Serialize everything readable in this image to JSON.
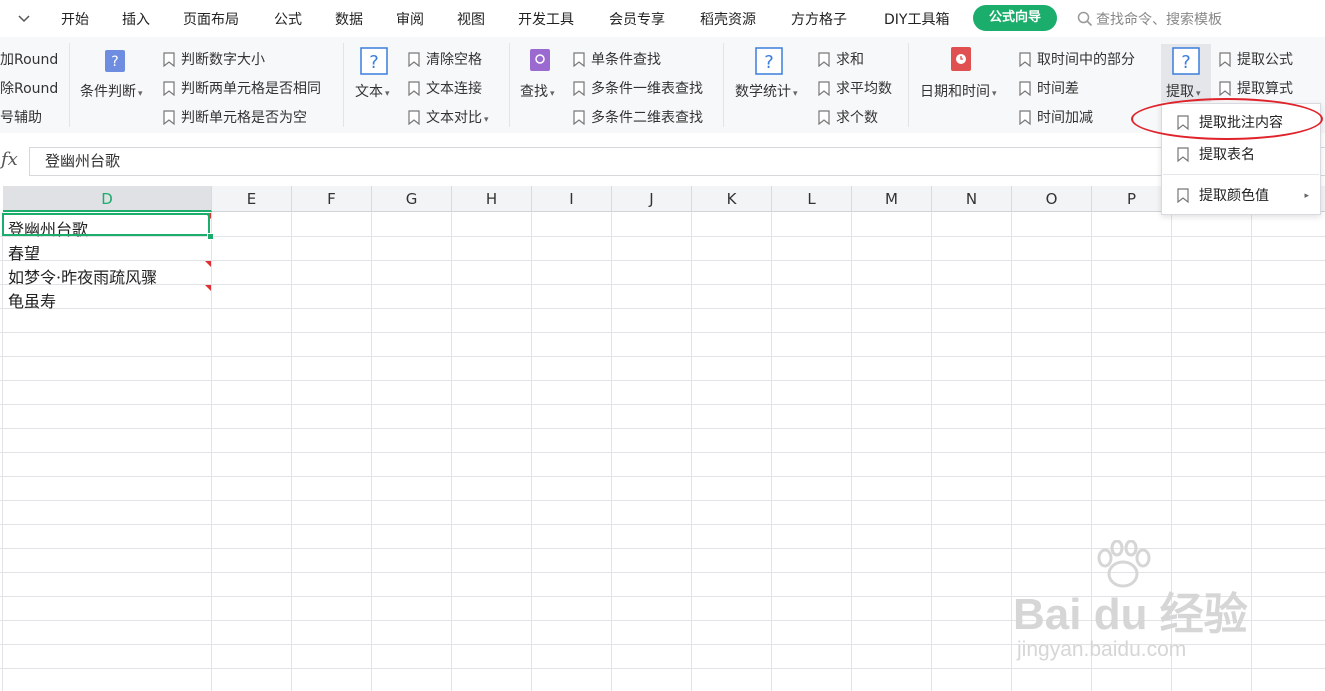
{
  "menu": {
    "tabs": [
      "开始",
      "插入",
      "页面布局",
      "公式",
      "数据",
      "审阅",
      "视图",
      "开发工具",
      "会员专享",
      "稻壳资源",
      "方方格子",
      "DIY工具箱"
    ],
    "active_tab": "公式向导",
    "search_placeholder": "查找命令、搜索模板"
  },
  "ribbon": {
    "round_group": [
      "加Round",
      "除Round",
      "号辅助"
    ],
    "condition_big": "条件判断",
    "condition_items": [
      "判断数字大小",
      "判断两单元格是否相同",
      "判断单元格是否为空"
    ],
    "text_big": "文本",
    "text_items": [
      "清除空格",
      "文本连接",
      "文本对比"
    ],
    "lookup_big": "查找",
    "lookup_items": [
      "单条件查找",
      "多条件一维表查找",
      "多条件二维表查找"
    ],
    "math_big": "数学统计",
    "math_items": [
      "求和",
      "求平均数",
      "求个数"
    ],
    "date_big": "日期和时间",
    "date_items": [
      "取时间中的部分",
      "时间差",
      "时间加减"
    ],
    "extract_big": "提取",
    "extract_items": [
      "提取公式",
      "提取算式"
    ]
  },
  "dropdown": {
    "items": [
      "提取批注内容",
      "提取表名",
      "提取颜色值"
    ]
  },
  "formula_bar": {
    "fx_label": "fx",
    "value": "登幽州台歌"
  },
  "columns": [
    "D",
    "E",
    "F",
    "G",
    "H",
    "I",
    "J",
    "K",
    "L",
    "M",
    "N",
    "O",
    "P"
  ],
  "selected_column": "D",
  "cells": [
    "登幽州台歌",
    "春望",
    "如梦令·昨夜雨疏风骤",
    "龟虽寿"
  ],
  "watermark": {
    "brand": "Bai du 经验",
    "url": "jingyan.baidu.com"
  },
  "colors": {
    "accent_green": "#1aad6b",
    "annotation_red": "#e0232a",
    "comment_marker": "#e03030"
  }
}
